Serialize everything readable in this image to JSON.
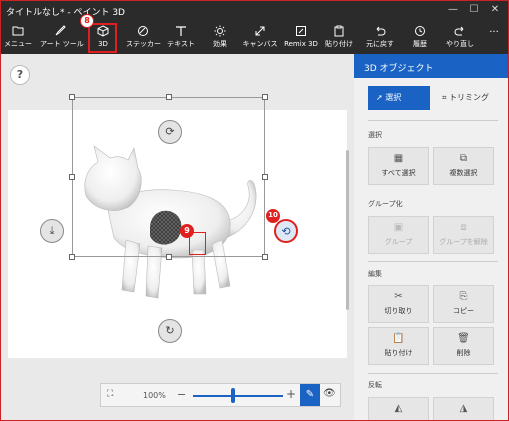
{
  "window": {
    "title": "タイトルなし* - ペイント 3D",
    "controls": [
      "minimize-icon",
      "maximize-icon",
      "close-icon"
    ]
  },
  "toolbar": {
    "tools": [
      {
        "id": "menu",
        "label": "メニュー",
        "icon": "folder-icon"
      },
      {
        "id": "art-tools",
        "label": "アート ツール",
        "icon": "brush-icon"
      },
      {
        "id": "3d",
        "label": "3D",
        "icon": "cube-icon"
      },
      {
        "id": "stickers",
        "label": "ステッカー",
        "icon": "sticker-icon"
      },
      {
        "id": "text",
        "label": "テキスト",
        "icon": "text-icon"
      },
      {
        "id": "effects",
        "label": "効果",
        "icon": "sun-icon"
      },
      {
        "id": "canvas",
        "label": "キャンバス",
        "icon": "resize-icon"
      },
      {
        "id": "remix3d",
        "label": "Remix 3D",
        "icon": "remix-icon"
      },
      {
        "id": "paste",
        "label": "貼り付け",
        "icon": "paste-icon"
      },
      {
        "id": "undo",
        "label": "元に戻す",
        "icon": "undo-icon"
      },
      {
        "id": "history",
        "label": "履歴",
        "icon": "history-icon"
      },
      {
        "id": "redo",
        "label": "やり直し",
        "icon": "redo-icon"
      }
    ],
    "more": "···"
  },
  "annotations": {
    "badge8": "8",
    "badge9": "9",
    "badge10": "10"
  },
  "canvas": {
    "help": "?",
    "object": "white-cat-3d-model"
  },
  "zoom": {
    "percent": "100%",
    "minus": "−",
    "plus": "+",
    "level": 100
  },
  "panel": {
    "title": "3D オブジェクト",
    "modes": {
      "select": "選択",
      "trim": "トリミング"
    },
    "sections": {
      "select": {
        "title": "選択",
        "buttons": {
          "select_all": "すべて選択",
          "multi_select": "複数選択"
        }
      },
      "group": {
        "title": "グループ化",
        "buttons": {
          "group": "グループ",
          "ungroup": "グループを解除"
        }
      },
      "edit": {
        "title": "編集",
        "buttons": {
          "cut": "切り取り",
          "copy": "コピー",
          "paste": "貼り付け",
          "delete": "削除"
        }
      },
      "flip": {
        "title": "反転"
      }
    }
  },
  "colors": {
    "accent": "#1a63c4",
    "annotation": "#e02020",
    "toolbar_bg": "#2b2b2b",
    "panel_bg": "#f0f0f0"
  }
}
